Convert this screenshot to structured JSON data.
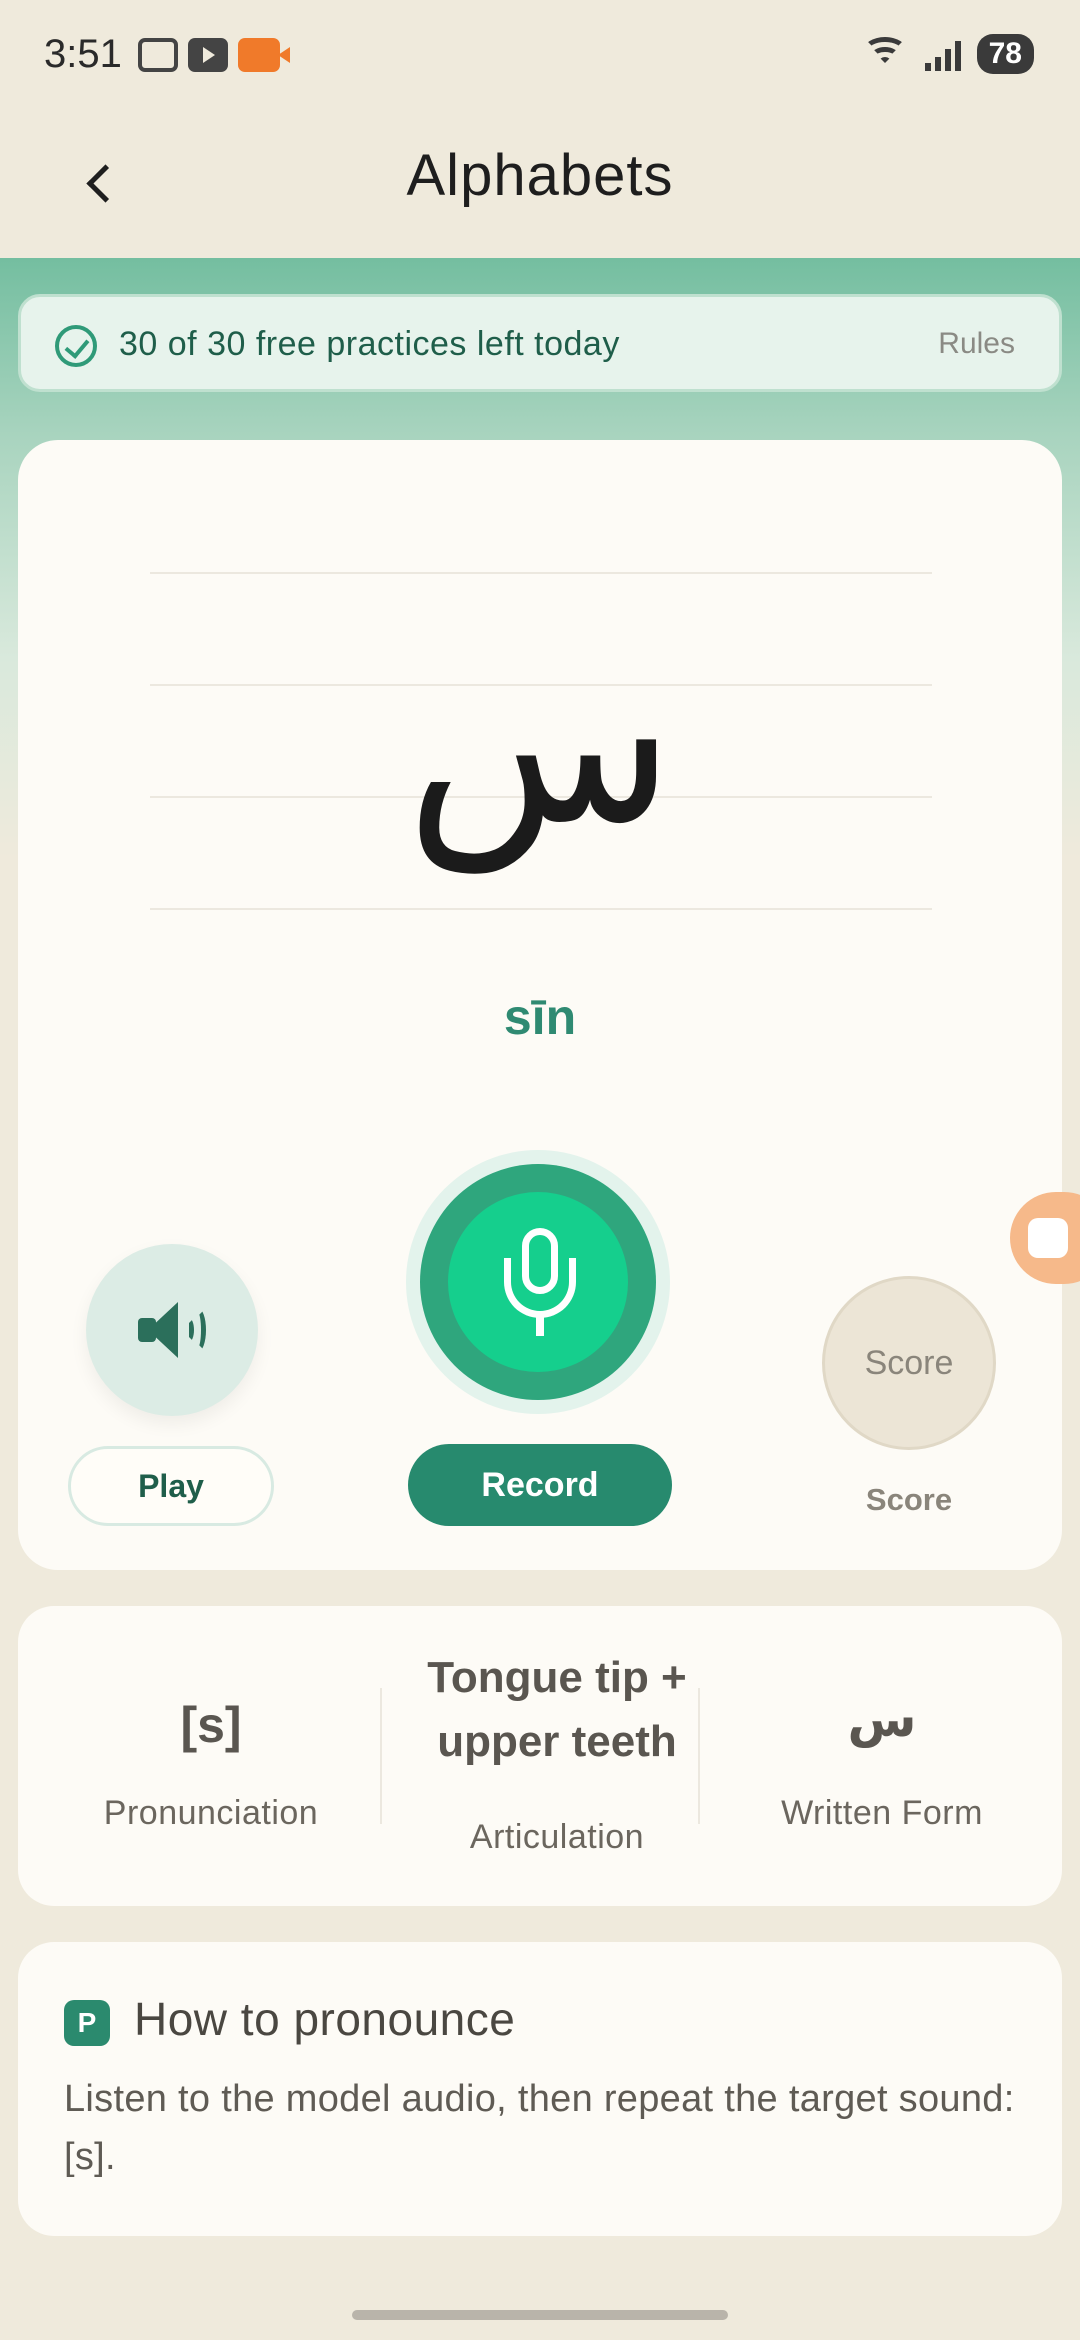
{
  "status_bar": {
    "time": "3:51",
    "battery": "78",
    "left_icons": [
      "screenshot-icon",
      "youtube-icon",
      "screen-record-icon"
    ],
    "right_icons": [
      "wifi-icon",
      "signal-icon",
      "battery-icon"
    ]
  },
  "header": {
    "title": "Alphabets",
    "back_icon": "chevron-left-icon"
  },
  "practice_banner": {
    "text": "30 of 30 free practices left today",
    "rules_label": "Rules",
    "icon": "check-circle-icon"
  },
  "letter_card": {
    "letter": "س",
    "transliteration": "sīn",
    "play_label": "Play",
    "record_label": "Record",
    "score_circle_text": "Score",
    "score_label": "Score"
  },
  "info": {
    "pronunciation": {
      "value": "[s]",
      "label": "Pronunciation"
    },
    "articulation": {
      "value_line1": "Tongue tip +",
      "value_line2": "upper teeth",
      "label": "Articulation"
    },
    "written_form": {
      "value": "س",
      "label": "Written Form"
    }
  },
  "how_to": {
    "badge": "P",
    "title": "How to pronounce",
    "body": "Listen to the model audio, then repeat the target sound: [s]."
  },
  "colors": {
    "accent": "#278a6e",
    "record_green": "#15cf8d",
    "background": "#efeadc",
    "card": "#fdfbf6"
  }
}
